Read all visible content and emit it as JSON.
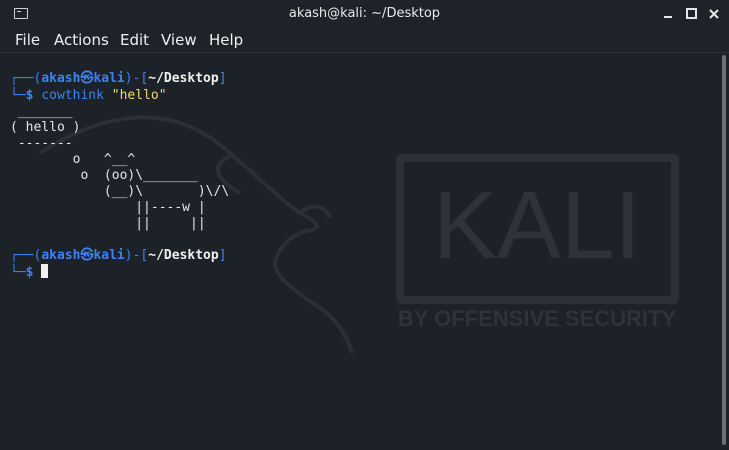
{
  "window": {
    "title": "akash@kali: ~/Desktop"
  },
  "menu": [
    "File",
    "Actions",
    "Edit",
    "View",
    "Help"
  ],
  "prompt1": {
    "frame_top": "┌──(",
    "user": "akash㉿kali",
    "frame_mid": ")-[",
    "path": "~/Desktop",
    "frame_end": "]",
    "frame_bottom": "└─",
    "dollar": "$",
    "command": "cowthink",
    "argument": "\"hello\""
  },
  "output": [
    " _______",
    "( hello )",
    " -------",
    "        o   ^__^",
    "         o  (oo)\\_______",
    "            (__)\\       )\\/\\",
    "                ||----w |",
    "                ||     ||"
  ],
  "prompt2": {
    "frame_top": "┌──(",
    "user": "akash㉿kali",
    "frame_mid": ")-[",
    "path": "~/Desktop",
    "frame_end": "]",
    "frame_bottom": "└─",
    "dollar": "$"
  },
  "watermark": {
    "logo": "KALI",
    "tagline": "BY OFFENSIVE SECURITY"
  },
  "icons": {
    "terminal": "terminal-icon",
    "minimize": "minimize-icon",
    "maximize": "maximize-icon",
    "close": "close-icon"
  }
}
